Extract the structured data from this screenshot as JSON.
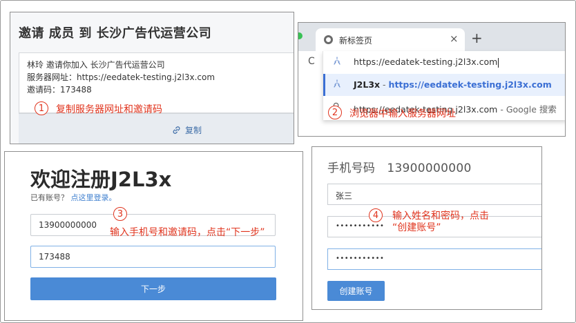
{
  "panel1": {
    "title": "邀请 成员 到 长沙广告代运营公司",
    "line1": "林玲 邀请你加入 长沙广告代运营公司",
    "line2": "服务器网址：https://eedatek-testing.j2l3x.com",
    "line3": "邀请码：173488",
    "copy_label": "复制",
    "step_number": "1",
    "step_note": "复制服务器网址和邀请码"
  },
  "panel2": {
    "tab_title": "新标签页",
    "tab_close": "×",
    "new_tab": "+",
    "reload": "C",
    "address_value": "https://eedatek-testing.j2l3x.com",
    "suggestion1_name": "J2L3x",
    "suggestion1_sep": " - ",
    "suggestion1_url": "https://eedatek-testing.j2l3x.com",
    "suggestion2_text": "https://eedatek-testing.j2l3x.com",
    "suggestion2_suffix": " - Google 搜索",
    "step_number": "2",
    "step_note": "浏览器中输入服务器网址"
  },
  "panel3": {
    "heading": "欢迎注册J2L3x",
    "have_account": "已有账号？",
    "login_link": "点这里登录。",
    "phone_value": "13900000000",
    "code_value": "173488",
    "next_button": "下一步",
    "step_number": "3",
    "step_note": "输入手机号和邀请码，点击“下一步”"
  },
  "panel4": {
    "phone_label": "手机号码",
    "phone_value": "13900000000",
    "name_value": "张三",
    "password_mask": "•••••••••••",
    "password_confirm_mask": "•••••••••••",
    "create_button": "创建账号",
    "step_number": "4",
    "step_note_line1": "输入姓名和密码，点击",
    "step_note_line2": "“创建账号”"
  },
  "colors": {
    "annotation_red": "#e0341e",
    "primary_blue": "#4a8ad6",
    "link_blue": "#3b6fd4"
  },
  "icons": {
    "copy": "link-icon",
    "chrome": "chrome-icon",
    "address_suggestion": "site-icon",
    "search": "search-icon"
  }
}
